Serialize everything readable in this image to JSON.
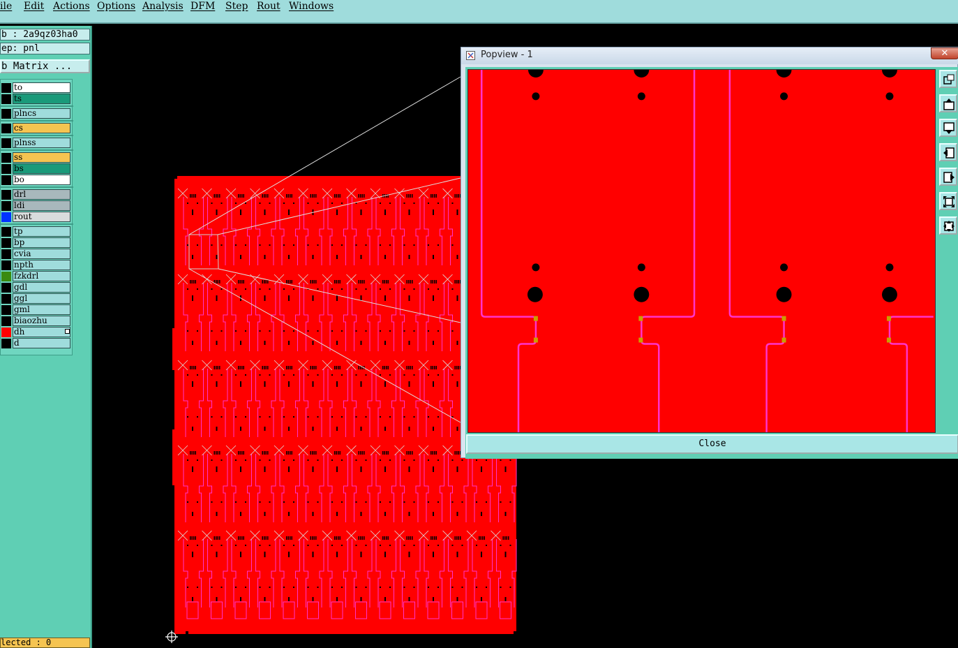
{
  "menu": {
    "items": [
      {
        "label": "ile"
      },
      {
        "label": "Edit"
      },
      {
        "label": "Actions"
      },
      {
        "label": "Options"
      },
      {
        "label": "Analysis"
      },
      {
        "label": "DFM"
      },
      {
        "label": "Step"
      },
      {
        "label": "Rout"
      },
      {
        "label": "Windows"
      }
    ]
  },
  "sidebar": {
    "job": "b : 2a9qz03ha0",
    "step": "ep: pnl",
    "matrix_button": "b Matrix ...",
    "layers": [
      {
        "name": "to",
        "bg": "#ffffff",
        "swatch": "#000000"
      },
      {
        "name": "ts",
        "bg": "#1a9a7a",
        "swatch": "#000000"
      },
      {
        "name": "plncs",
        "bg": "#9fdcdc",
        "swatch": "#000000"
      },
      {
        "name": "cs",
        "bg": "#f5c451",
        "swatch": "#000000"
      },
      {
        "name": "plnss",
        "bg": "#9fdcdc",
        "swatch": "#000000"
      },
      {
        "name": "ss",
        "bg": "#f5c451",
        "swatch": "#000000"
      },
      {
        "name": "bs",
        "bg": "#1a9a7a",
        "swatch": "#000000"
      },
      {
        "name": "bo",
        "bg": "#ffffff",
        "swatch": "#000000"
      },
      {
        "name": "drl",
        "bg": "#a8b8bc",
        "swatch": "#000000"
      },
      {
        "name": "ldi",
        "bg": "#a8b8bc",
        "swatch": "#000000"
      },
      {
        "name": "rout",
        "bg": "#d8dcdc",
        "swatch": "#0033ff"
      },
      {
        "name": "tp",
        "bg": "#9fdcdc",
        "swatch": "#000000"
      },
      {
        "name": "bp",
        "bg": "#9fdcdc",
        "swatch": "#000000"
      },
      {
        "name": "cvia",
        "bg": "#9fdcdc",
        "swatch": "#000000"
      },
      {
        "name": "npth",
        "bg": "#9fdcdc",
        "swatch": "#000000"
      },
      {
        "name": "fzkdrl",
        "bg": "#9fdcdc",
        "swatch": "#3a8a10"
      },
      {
        "name": "gdl",
        "bg": "#9fdcdc",
        "swatch": "#000000"
      },
      {
        "name": "ggl",
        "bg": "#9fdcdc",
        "swatch": "#000000"
      },
      {
        "name": "gml",
        "bg": "#9fdcdc",
        "swatch": "#000000"
      },
      {
        "name": "biaozhu",
        "bg": "#9fdcdc",
        "swatch": "#000000"
      },
      {
        "name": "dh",
        "bg": "#9fdcdc",
        "swatch": "#ff0000"
      },
      {
        "name": "d",
        "bg": "#9fdcdc",
        "swatch": "#000000"
      }
    ],
    "selected_text": "lected : 0"
  },
  "popview": {
    "title": "Popview - 1",
    "close_label": "Close",
    "tool_icons": [
      "zoom-home-icon",
      "pan-up-icon",
      "pan-down-icon",
      "pan-left-icon",
      "pan-right-icon",
      "zoom-in-icon",
      "zoom-out-icon"
    ]
  },
  "colors": {
    "board": "#ff0000",
    "rout_line": "#ff33cc",
    "panel": "#5fcfb4",
    "menubar": "#9fdcdc"
  }
}
